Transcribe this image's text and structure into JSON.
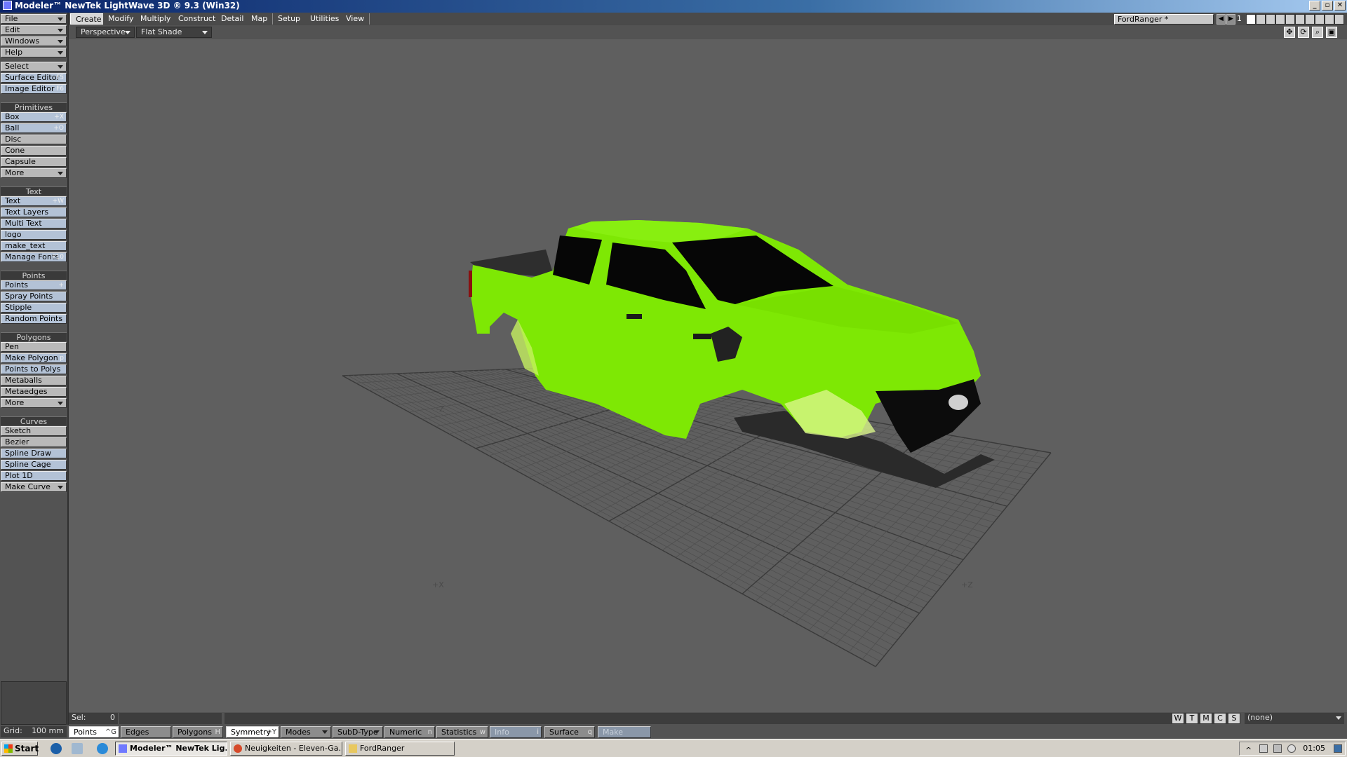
{
  "window": {
    "title": "Modeler™ NewTek LightWave 3D ® 9.3 (Win32)",
    "min_label": "_",
    "max_label": "▫",
    "close_label": "✕"
  },
  "sidebar": {
    "top_menus": [
      {
        "label": "File"
      },
      {
        "label": "Edit"
      },
      {
        "label": "Windows"
      },
      {
        "label": "Help"
      }
    ],
    "select_label": "Select",
    "surface_editor": {
      "label": "Surface Editor",
      "shortcut": "F5"
    },
    "image_editor": {
      "label": "Image Editor",
      "shortcut": "F6"
    },
    "sections": {
      "primitives": "Primitives",
      "text": "Text",
      "points": "Points",
      "polygons": "Polygons",
      "curves": "Curves"
    },
    "primitives": [
      {
        "label": "Box",
        "shortcut": "+X"
      },
      {
        "label": "Ball",
        "shortcut": "+O"
      },
      {
        "label": "Disc",
        "shortcut": ""
      },
      {
        "label": "Cone",
        "shortcut": ""
      },
      {
        "label": "Capsule",
        "shortcut": ""
      },
      {
        "label": "More",
        "shortcut": ""
      }
    ],
    "text": [
      {
        "label": "Text",
        "shortcut": "+W"
      },
      {
        "label": "Text Layers",
        "shortcut": ""
      },
      {
        "label": "Multi Text",
        "shortcut": ""
      },
      {
        "label": "logo",
        "shortcut": ""
      },
      {
        "label": "make_text",
        "shortcut": ""
      },
      {
        "label": "Manage Fonts",
        "shortcut": "F10"
      }
    ],
    "points": [
      {
        "label": "Points",
        "shortcut": "+"
      },
      {
        "label": "Spray Points",
        "shortcut": ""
      },
      {
        "label": "Stipple",
        "shortcut": ""
      },
      {
        "label": "Random Points",
        "shortcut": ""
      }
    ],
    "polygons": [
      {
        "label": "Pen",
        "shortcut": ""
      },
      {
        "label": "Make Polygon",
        "shortcut": "p"
      },
      {
        "label": "Points to Polys",
        "shortcut": ""
      },
      {
        "label": "Metaballs",
        "shortcut": ""
      },
      {
        "label": "Metaedges",
        "shortcut": ""
      },
      {
        "label": "More",
        "shortcut": ""
      }
    ],
    "curves": [
      {
        "label": "Sketch",
        "shortcut": ""
      },
      {
        "label": "Bezier",
        "shortcut": ""
      },
      {
        "label": "Spline Draw",
        "shortcut": ""
      },
      {
        "label": "Spline Cage",
        "shortcut": ""
      },
      {
        "label": "Plot 1D",
        "shortcut": ""
      },
      {
        "label": "Make Curve",
        "shortcut": ""
      }
    ]
  },
  "tabs": [
    "Create",
    "Modify",
    "Multiply",
    "Construct",
    "Detail",
    "Map",
    "Setup",
    "Utilities",
    "View"
  ],
  "active_tab": "Create",
  "scene": {
    "name": "FordRanger *",
    "layer_number": "1"
  },
  "viewport": {
    "view_mode": "Perspective",
    "shading": "Flat Shade",
    "axis_labels": {
      "x": "+X",
      "z": "+Z",
      "z_far": "-Z"
    }
  },
  "status": {
    "sel_label": "Sel:",
    "sel_value": "0",
    "grid_label": "Grid:",
    "grid_value": "100 mm",
    "wtmcs": [
      "W",
      "T",
      "M",
      "C",
      "S"
    ],
    "surface_dropdown": "(none)"
  },
  "modes": {
    "points": {
      "label": "Points",
      "shortcut": "^G"
    },
    "edges": {
      "label": "Edges",
      "shortcut": ""
    },
    "polygons": {
      "label": "Polygons",
      "shortcut": "H"
    },
    "symmetry": {
      "label": "Symmetry",
      "shortcut": "+Y"
    },
    "modes_label": "Modes",
    "subd_label": "SubD-Type",
    "numeric": {
      "label": "Numeric",
      "shortcut": "n"
    },
    "statistics": {
      "label": "Statistics",
      "shortcut": "w"
    },
    "info": {
      "label": "Info",
      "shortcut": "i"
    },
    "surface": {
      "label": "Surface",
      "shortcut": "q"
    },
    "make": {
      "label": "Make",
      "shortcut": ""
    }
  },
  "taskbar": {
    "start": "Start",
    "tasks": [
      {
        "label": "Modeler™ NewTek Lig...",
        "active": true
      },
      {
        "label": "Neuigkeiten - Eleven-Ga...",
        "active": false
      },
      {
        "label": "FordRanger",
        "active": false
      }
    ],
    "clock": "01:05"
  },
  "colors": {
    "car_body": "#7ee804",
    "window_glass": "#060606",
    "viewport_bg": "#5f5f5f",
    "grid_line": "#4f4f4f"
  }
}
